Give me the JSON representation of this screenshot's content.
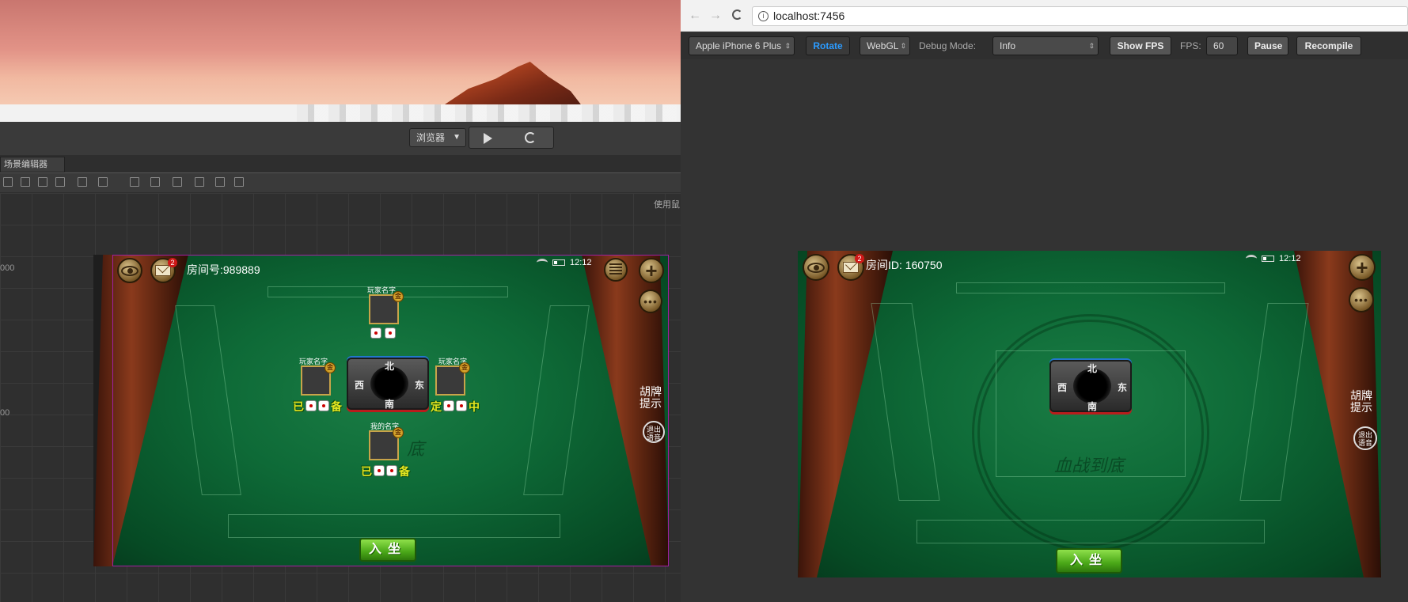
{
  "editor": {
    "preview_select": "浏览器",
    "tab_label": "场景编辑器",
    "use_label": "使用鼠",
    "ruler_labels": [
      "000",
      "00"
    ]
  },
  "browser": {
    "url": "localhost:7456",
    "info_icon": "i",
    "toolbar": {
      "device": "Apple iPhone 6 Plus",
      "rotate": "Rotate",
      "renderer": "WebGL",
      "debug_label": "Debug Mode:",
      "debug_value": "Info",
      "show_fps": "Show FPS",
      "fps_label": "FPS:",
      "fps_value": "60",
      "pause": "Pause",
      "recompile": "Recompile"
    }
  },
  "game_editor": {
    "room_label": "房间号:989889",
    "mail_badge": "2",
    "time": "12:12",
    "players": {
      "top": {
        "name": "玩家名字",
        "ready": ""
      },
      "left": {
        "name": "玩家名字",
        "ready_a": "已",
        "ready_b": "备"
      },
      "right": {
        "name": "玩家名字",
        "ready_a": "定",
        "ready_b": "中"
      },
      "me": {
        "name": "我的名字",
        "ready_a": "已",
        "ready_b": "备"
      }
    },
    "coin_mark": "金",
    "compass": {
      "north": "北",
      "south": "南",
      "east": "东",
      "west": "西"
    },
    "hint": [
      "胡牌",
      "提示"
    ],
    "exit_voice": [
      "退出",
      "语音"
    ],
    "sit_button": "入坐",
    "watermark": "底"
  },
  "game_preview": {
    "room_label": "房间ID:  160750",
    "mail_badge": "2",
    "time": "12:12",
    "compass": {
      "north": "北",
      "south": "南",
      "east": "东",
      "west": "西"
    },
    "hint": [
      "胡牌",
      "提示"
    ],
    "exit_voice": [
      "退出",
      "语音"
    ],
    "sit_button": "入坐",
    "watermark": "血战到底"
  },
  "colors": {
    "felt": "#0e6a37",
    "rail": "#8a3a1c",
    "accent_blue": "#2b9bff",
    "sit_green": "#4aa818"
  }
}
